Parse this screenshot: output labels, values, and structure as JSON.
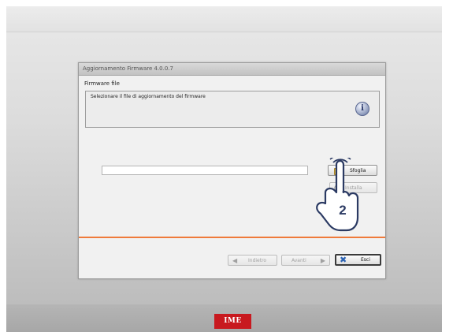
{
  "dialog": {
    "title": "Aggiornamento Firmware 4.0.0.7",
    "section_title": "Firmware file",
    "info_text": "Selezionare il file di aggiornamento del firmware",
    "info_icon": "info-icon",
    "file_input": {
      "value": "",
      "placeholder": ""
    },
    "browse_label": "Sfoglia",
    "aux_label": "Installa",
    "back_label": "Indietro",
    "next_label": "Avanti",
    "exit_label": "Esci"
  },
  "annotation": {
    "step_number": "2"
  },
  "brand": {
    "logo_text": "IME",
    "color": "#c8191f"
  },
  "colors": {
    "separator": "#ef7a3b",
    "exit_icon": "#2c63b3"
  }
}
